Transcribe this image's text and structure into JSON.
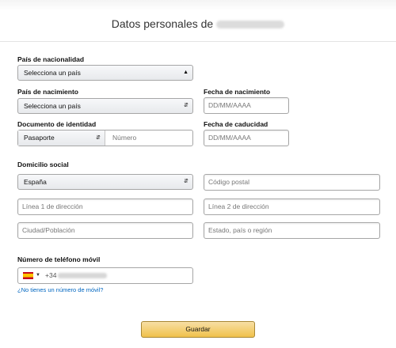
{
  "header": {
    "title": "Datos personales de"
  },
  "form": {
    "nacionalidad": {
      "label": "País de nacionalidad",
      "value": "Selecciona un país"
    },
    "nacimiento": {
      "label": "País de nacimiento",
      "value": "Selecciona un país"
    },
    "fecha_nacimiento": {
      "label": "Fecha de nacimiento",
      "placeholder": "DD/MM/AAAA"
    },
    "documento": {
      "label": "Documento de identidad",
      "type_value": "Pasaporte",
      "number_placeholder": "Número"
    },
    "fecha_caducidad": {
      "label": "Fecha de caducidad",
      "placeholder": "DD/MM/AAAA"
    },
    "domicilio": {
      "label": "Domicilio social",
      "country_value": "España",
      "postal_placeholder": "Código postal",
      "line1_placeholder": "Línea 1 de dirección",
      "line2_placeholder": "Línea 2 de dirección",
      "city_placeholder": "Ciudad/Población",
      "region_placeholder": "Estado, país o región"
    },
    "telefono": {
      "label": "Número de teléfono móvil",
      "country_code": "+34",
      "flag_icon": "spain-flag-icon"
    },
    "no_phone_link": "¿No tienes un número de móvil?",
    "save_label": "Guardar"
  },
  "colors": {
    "link": "#0066c0",
    "button": "#f0c14b",
    "border": "#a6a6a6"
  }
}
